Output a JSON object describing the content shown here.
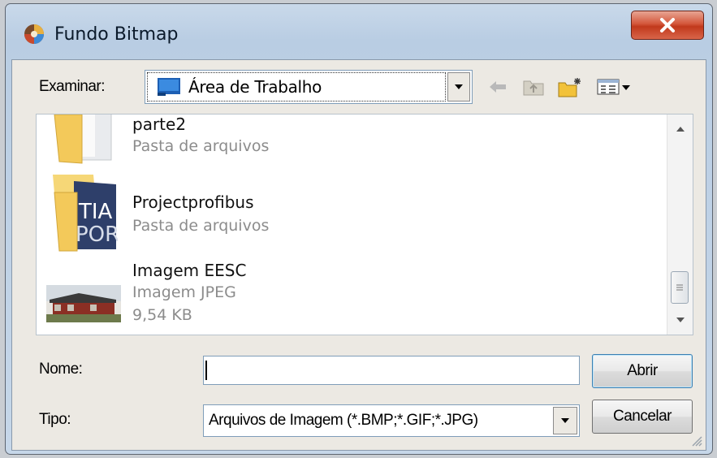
{
  "window": {
    "title": "Fundo Bitmap",
    "close_label": "X",
    "accent": "#c1391c"
  },
  "lookin": {
    "label": "Examinar:",
    "value": "Área de Trabalho",
    "icon": "desktop-icon"
  },
  "toolbar": {
    "icons": [
      "back-arrow-icon",
      "up-folder-icon",
      "new-folder-icon",
      "view-menu-icon"
    ]
  },
  "files": [
    {
      "name": "parte2",
      "type": "Pasta de arquivos",
      "size": "",
      "icon": "folder-icon"
    },
    {
      "name": "Projectprofibus",
      "type": "Pasta de arquivos",
      "size": "",
      "icon": "folder-icon"
    },
    {
      "name": "Imagem EESC",
      "type": "Imagem JPEG",
      "size": "9,54 KB",
      "icon": "jpeg-thumbnail"
    }
  ],
  "filename": {
    "label": "Nome:",
    "value": ""
  },
  "filetype": {
    "label": "Tipo:",
    "value": "Arquivos de Imagem (*.BMP;*.GIF;*.JPG)"
  },
  "buttons": {
    "open": "Abrir",
    "cancel": "Cancelar"
  }
}
